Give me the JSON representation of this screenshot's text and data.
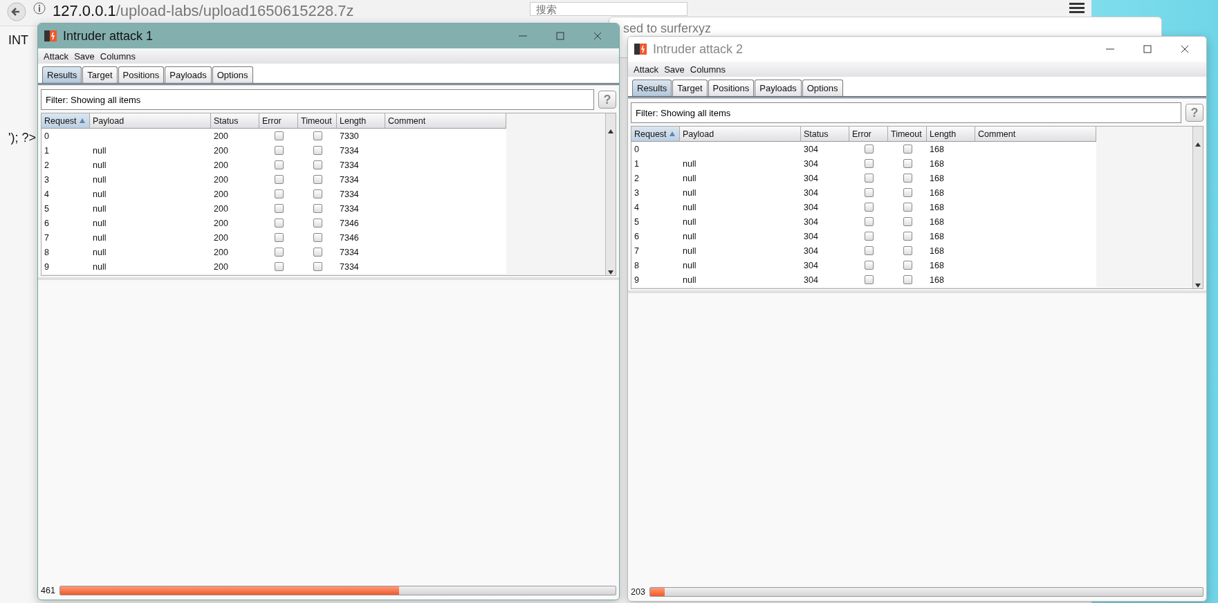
{
  "browser": {
    "url_host": "127.0.0.1",
    "url_path": "/upload-labs/upload1650615228.7z",
    "search_placeholder": "搜索",
    "side_label": "INT",
    "page_text": "'); ?>"
  },
  "back_window": {
    "title": "sed to surferxyz"
  },
  "windows": [
    {
      "title": "Intruder attack 1",
      "active": true,
      "menu": [
        "Attack",
        "Save",
        "Columns"
      ],
      "tabs": [
        {
          "label": "Results",
          "selected": true
        },
        {
          "label": "Target",
          "selected": false
        },
        {
          "label": "Positions",
          "selected": false
        },
        {
          "label": "Payloads",
          "selected": false
        },
        {
          "label": "Options",
          "selected": false
        }
      ],
      "filter": "Filter: Showing all items",
      "help": "?",
      "columns": [
        {
          "label": "Request",
          "sorted": true
        },
        {
          "label": "Payload",
          "sorted": false
        },
        {
          "label": "Status",
          "sorted": false
        },
        {
          "label": "Error",
          "sorted": false
        },
        {
          "label": "Timeout",
          "sorted": false
        },
        {
          "label": "Length",
          "sorted": false
        },
        {
          "label": "Comment",
          "sorted": false
        }
      ],
      "rows": [
        {
          "request": "0",
          "payload": "",
          "status": "200",
          "error": false,
          "timeout": false,
          "length": "7330"
        },
        {
          "request": "1",
          "payload": "null",
          "status": "200",
          "error": false,
          "timeout": false,
          "length": "7334"
        },
        {
          "request": "2",
          "payload": "null",
          "status": "200",
          "error": false,
          "timeout": false,
          "length": "7334"
        },
        {
          "request": "3",
          "payload": "null",
          "status": "200",
          "error": false,
          "timeout": false,
          "length": "7334"
        },
        {
          "request": "4",
          "payload": "null",
          "status": "200",
          "error": false,
          "timeout": false,
          "length": "7334"
        },
        {
          "request": "5",
          "payload": "null",
          "status": "200",
          "error": false,
          "timeout": false,
          "length": "7334"
        },
        {
          "request": "6",
          "payload": "null",
          "status": "200",
          "error": false,
          "timeout": false,
          "length": "7346"
        },
        {
          "request": "7",
          "payload": "null",
          "status": "200",
          "error": false,
          "timeout": false,
          "length": "7346"
        },
        {
          "request": "8",
          "payload": "null",
          "status": "200",
          "error": false,
          "timeout": false,
          "length": "7334"
        },
        {
          "request": "9",
          "payload": "null",
          "status": "200",
          "error": false,
          "timeout": false,
          "length": "7334"
        }
      ],
      "progress": {
        "count": "461",
        "level": 0.61
      }
    },
    {
      "title": "Intruder attack 2",
      "active": false,
      "menu": [
        "Attack",
        "Save",
        "Columns"
      ],
      "tabs": [
        {
          "label": "Results",
          "selected": true
        },
        {
          "label": "Target",
          "selected": false
        },
        {
          "label": "Positions",
          "selected": false
        },
        {
          "label": "Payloads",
          "selected": false
        },
        {
          "label": "Options",
          "selected": false
        }
      ],
      "filter": "Filter: Showing all items",
      "help": "?",
      "columns": [
        {
          "label": "Request",
          "sorted": true
        },
        {
          "label": "Payload",
          "sorted": false
        },
        {
          "label": "Status",
          "sorted": false
        },
        {
          "label": "Error",
          "sorted": false
        },
        {
          "label": "Timeout",
          "sorted": false
        },
        {
          "label": "Length",
          "sorted": false
        },
        {
          "label": "Comment",
          "sorted": false
        }
      ],
      "rows": [
        {
          "request": "0",
          "payload": "",
          "status": "304",
          "error": false,
          "timeout": false,
          "length": "168"
        },
        {
          "request": "1",
          "payload": "null",
          "status": "304",
          "error": false,
          "timeout": false,
          "length": "168"
        },
        {
          "request": "2",
          "payload": "null",
          "status": "304",
          "error": false,
          "timeout": false,
          "length": "168"
        },
        {
          "request": "3",
          "payload": "null",
          "status": "304",
          "error": false,
          "timeout": false,
          "length": "168"
        },
        {
          "request": "4",
          "payload": "null",
          "status": "304",
          "error": false,
          "timeout": false,
          "length": "168"
        },
        {
          "request": "5",
          "payload": "null",
          "status": "304",
          "error": false,
          "timeout": false,
          "length": "168"
        },
        {
          "request": "6",
          "payload": "null",
          "status": "304",
          "error": false,
          "timeout": false,
          "length": "168"
        },
        {
          "request": "7",
          "payload": "null",
          "status": "304",
          "error": false,
          "timeout": false,
          "length": "168"
        },
        {
          "request": "8",
          "payload": "null",
          "status": "304",
          "error": false,
          "timeout": false,
          "length": "168"
        },
        {
          "request": "9",
          "payload": "null",
          "status": "304",
          "error": false,
          "timeout": false,
          "length": "168"
        }
      ],
      "progress": {
        "count": "203",
        "level": 0.027
      }
    }
  ]
}
